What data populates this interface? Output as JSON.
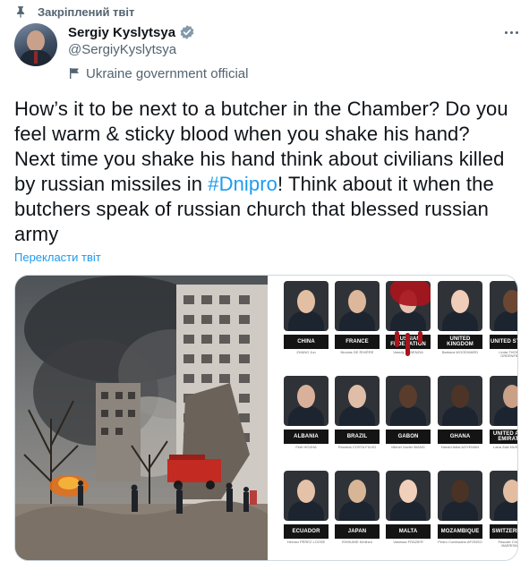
{
  "pinned": {
    "label": "Закріплений твіт"
  },
  "author": {
    "display_name": "Sergiy Kyslytsya",
    "handle": "@SergiyKyslytsya",
    "affiliation": "Ukraine government official"
  },
  "tweet": {
    "text_part1": "How’s it to be next to a butcher in the Chamber? Do you feel warm & sticky blood when you shake his hand? Next time you shake his hand think about civilians killed by russian missiles in ",
    "hashtag": "#Dnipro",
    "text_part2": "! Think about it when the butchers speak of russian church that blessed russian army",
    "translate_label": "Перекласти твіт"
  },
  "icons": {
    "pin": "pin-icon",
    "verified": "verified-badge-icon",
    "affiliation": "ukraine-flag-icon",
    "more": "more-options-icon"
  },
  "colors": {
    "link": "#1d9bf0",
    "verified": "#1d9bf0",
    "text": "#0f1419",
    "muted": "#536471",
    "blood": "#a8141c"
  },
  "board": {
    "members": [
      {
        "country": "CHINA",
        "person": "ZHANG Jun"
      },
      {
        "country": "FRANCE",
        "person": "Nicolas DE RIVIÈRE"
      },
      {
        "country": "RUSSIAN FEDERATION",
        "person": "Vassily NEBENZIA"
      },
      {
        "country": "UNITED KINGDOM",
        "person": "Barbara WOODWARD"
      },
      {
        "country": "UNITED STATES",
        "person": "Linda THOMAS-GREENFIELD"
      },
      {
        "country": "ALBANIA",
        "person": "Ferit HOXHA"
      },
      {
        "country": "BRAZIL",
        "person": "Ronaldo COSTA FILHO"
      },
      {
        "country": "GABON",
        "person": "Michel Xavier BIANG"
      },
      {
        "country": "GHANA",
        "person": "Harold Adlai AGYEMAN"
      },
      {
        "country": "UNITED ARAB EMIRATES",
        "person": "Lana Zaki NUSSEIBEH"
      },
      {
        "country": "ECUADOR",
        "person": "Hernán PÉREZ LOOSE"
      },
      {
        "country": "JAPAN",
        "person": "ISHIKANE Kimihiro"
      },
      {
        "country": "MALTA",
        "person": "Vanessa FRAZIER"
      },
      {
        "country": "MOZAMBIQUE",
        "person": "Pedro Comissário AFONSO"
      },
      {
        "country": "SWITZERLAND",
        "person": "Pascale Christine BAERISWYL"
      }
    ]
  }
}
